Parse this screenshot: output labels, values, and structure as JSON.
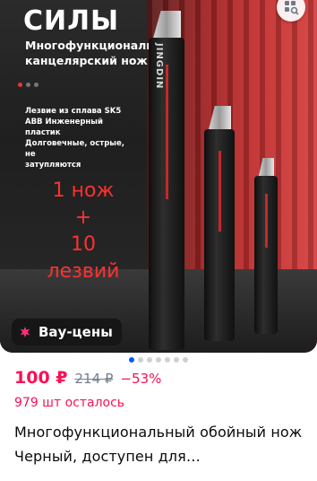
{
  "product_image": {
    "headline_top": "СИЛЫ",
    "subtitle_line1": "Многофункциональный",
    "subtitle_line2": "канцелярский нож",
    "features_line1": "Лезвие из сплава SK5",
    "features_line2": "ABB Инженерный пластик",
    "features_line3": "Долговечные, острые, не",
    "features_line4": "затупляются",
    "promo_line1": "1 нож",
    "promo_line2": "+",
    "promo_line3": "10 лезвий",
    "knife_brand": "JINGDIN",
    "accent_color": "#c62828"
  },
  "badge": {
    "label": "Вау-цены",
    "icon": "burst-star-icon",
    "color": "#ff2e7e"
  },
  "similar_button": {
    "icon": "similar-search-icon"
  },
  "carousel": {
    "total": 7,
    "current": 1
  },
  "price": {
    "current": "100 ₽",
    "old": "214 ₽",
    "discount": "−53%"
  },
  "stock_text": "979 шт осталось",
  "title": "Многофункциональный обойный нож Черный, доступен для…",
  "colors": {
    "price": "#f91155",
    "active_dot": "#005bff"
  }
}
